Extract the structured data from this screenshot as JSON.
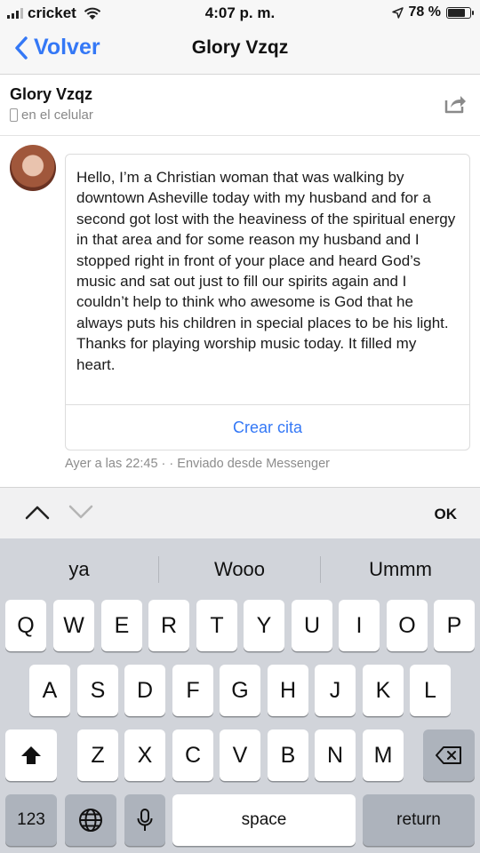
{
  "status_bar": {
    "carrier": "cricket",
    "time": "4:07 p. m.",
    "battery": "78 %",
    "battery_level": 0.78
  },
  "nav": {
    "back_label": "Volver",
    "title": "Glory Vzqz"
  },
  "contact": {
    "name": "Glory Vzqz",
    "status": "en el celular"
  },
  "message": {
    "text": "Hello, I’m a Christian woman that was walking by downtown Asheville today with my husband and for a second got lost with the heaviness of the spiritual energy in that area and for some reason my husband and I stopped right in front of your place and heard God’s music and sat out just to fill our spirits again and I couldn’t help to think who awesome is God that he always puts his children in special places to be his light. Thanks for playing worship music today. It filled my heart.",
    "action_label": "Crear cita",
    "meta": "Ayer a las 22:45 · · Enviado desde Messenger"
  },
  "accessory": {
    "ok_label": "OK"
  },
  "keyboard": {
    "suggestions": [
      "ya",
      "Wooo",
      "Ummm"
    ],
    "row1": [
      "Q",
      "W",
      "E",
      "R",
      "T",
      "Y",
      "U",
      "I",
      "O",
      "P"
    ],
    "row2": [
      "A",
      "S",
      "D",
      "F",
      "G",
      "H",
      "J",
      "K",
      "L"
    ],
    "row3": [
      "Z",
      "X",
      "C",
      "V",
      "B",
      "N",
      "M"
    ],
    "numbers_label": "123",
    "space_label": "space",
    "return_label": "return"
  }
}
